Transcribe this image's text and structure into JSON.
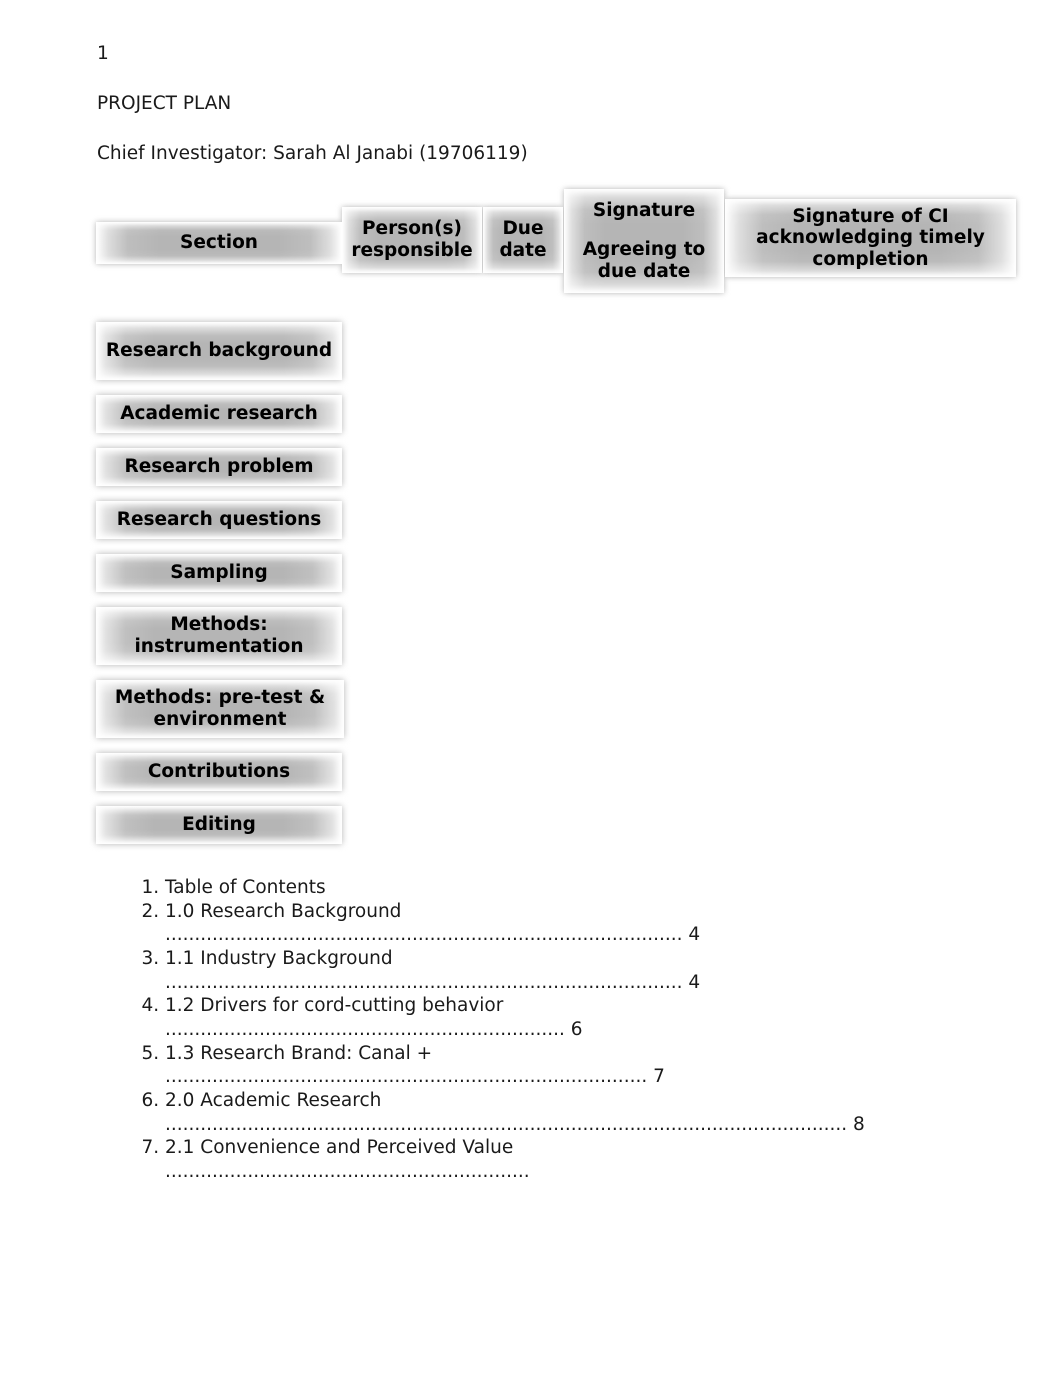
{
  "document": {
    "page_number": "1",
    "title": "PROJECT PLAN",
    "investigator": "Chief Investigator: Sarah Al Janabi (19706119)"
  },
  "table": {
    "headers": {
      "section": "Section",
      "person_responsible": "Person(s) responsible",
      "due_date": "Due date",
      "signature_top": "Signature",
      "signature_bottom": "Agreeing to due date",
      "signature_ci": "Signature of CI acknowledging timely completion"
    },
    "rows": [
      {
        "section": "Research background",
        "person": "",
        "due": "",
        "signature": "",
        "signature_ci": ""
      },
      {
        "section": "Academic research",
        "person": "",
        "due": "",
        "signature": "",
        "signature_ci": ""
      },
      {
        "section": "Research problem",
        "person": "",
        "due": "",
        "signature": "",
        "signature_ci": ""
      },
      {
        "section": "Research questions",
        "person": "",
        "due": "",
        "signature": "",
        "signature_ci": ""
      },
      {
        "section": "Sampling",
        "person": "",
        "due": "",
        "signature": "",
        "signature_ci": ""
      },
      {
        "section": "Methods: instrumentation",
        "person": "",
        "due": "",
        "signature": "",
        "signature_ci": ""
      },
      {
        "section": "Methods: pre-test & environment",
        "person": "",
        "due": "",
        "signature": "",
        "signature_ci": ""
      },
      {
        "section": "Contributions",
        "person": "",
        "due": "",
        "signature": "",
        "signature_ci": ""
      },
      {
        "section": "Editing",
        "person": "",
        "due": "",
        "signature": "",
        "signature_ci": ""
      }
    ]
  },
  "toc": {
    "items": [
      {
        "title": "Table of Contents",
        "leader": "",
        "page": ""
      },
      {
        "title": "1.0 Research Background",
        "leader": "........................................................................................",
        "page": "4"
      },
      {
        "title": "1.1 Industry Background",
        "leader": "........................................................................................",
        "page": "4"
      },
      {
        "title": "1.2 Drivers for cord-cutting behavior",
        "leader": "....................................................................",
        "page": "6"
      },
      {
        "title": "1.3 Research Brand: Canal +",
        "leader": "..................................................................................",
        "page": "7"
      },
      {
        "title": "2.0 Academic Research",
        "leader": "....................................................................................................................",
        "page": "8"
      },
      {
        "title": "2.1 Convenience and Perceived Value",
        "leader": "..............................................................",
        "page": ""
      }
    ]
  },
  "colors": {
    "cell_gray": "#b5b5b5",
    "text": "#000000",
    "body_text": "#1a1a1a",
    "page_background": "#ffffff"
  }
}
